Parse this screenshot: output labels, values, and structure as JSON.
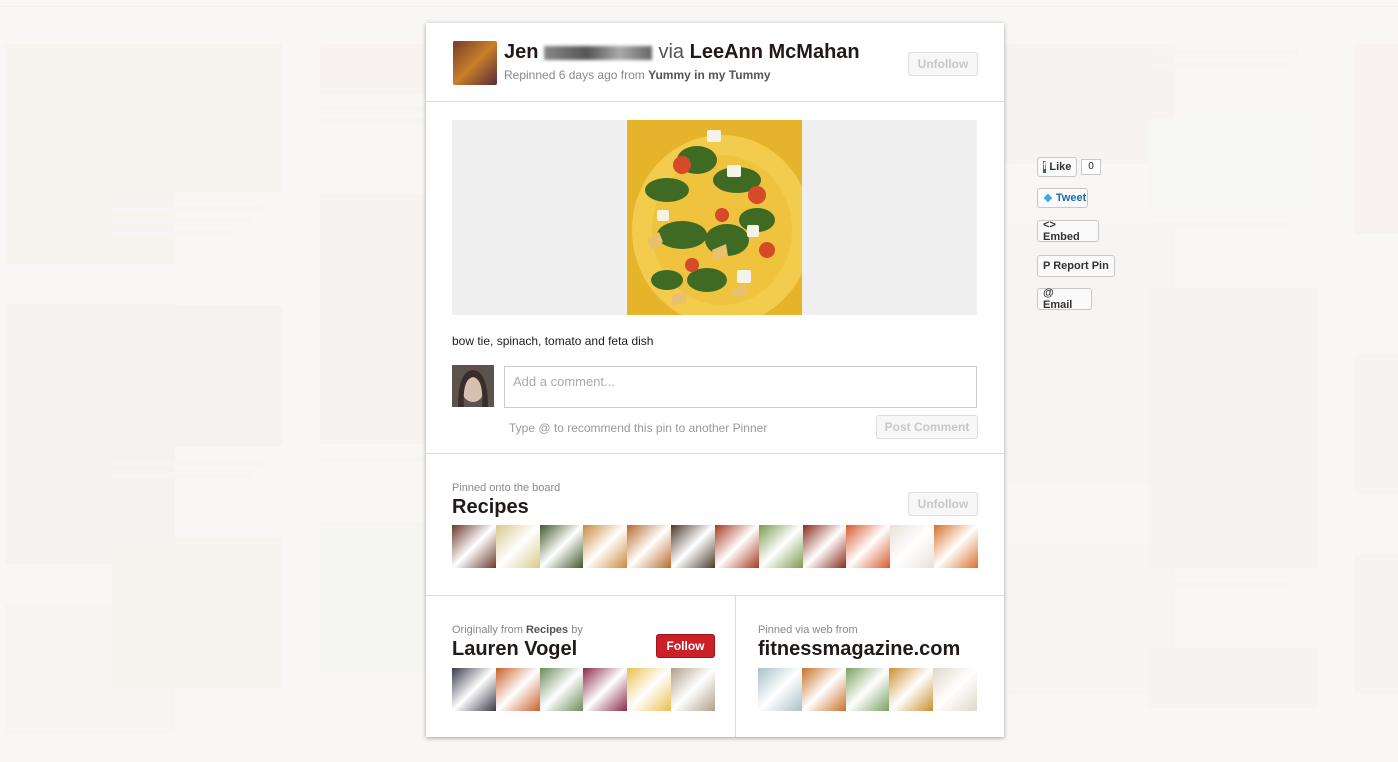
{
  "pin": {
    "pinner_first_name": "Jen",
    "via_text": "via",
    "via_user": "LeeAnn McMahan",
    "repinned_text": "Repinned 6 days ago from",
    "source_board": "Yummy in my Tummy",
    "unfollow_label": "Unfollow",
    "description": "bow tie, spinach, tomato and feta dish"
  },
  "comment": {
    "placeholder": "Add a comment...",
    "hint": "Type @ to recommend this pin to another Pinner",
    "post_label": "Post Comment"
  },
  "board": {
    "caption": "Pinned onto the board",
    "name": "Recipes",
    "unfollow_label": "Unfollow",
    "thumb_colors": [
      "#6b3a2a",
      "#d8c98a",
      "#3f5a2a",
      "#c98b3a",
      "#b86a2a",
      "#4a3a2a",
      "#a8381e",
      "#7c9a4a",
      "#8a2a1e",
      "#d8582a",
      "#e8e0d8",
      "#d8702a"
    ]
  },
  "origin": {
    "caption_prefix": "Originally from",
    "caption_board": "Recipes",
    "caption_suffix": "by",
    "user_name": "Lauren Vogel",
    "follow_label": "Follow",
    "thumb_colors": [
      "#3a3a4a",
      "#c8602a",
      "#6a8a5a",
      "#8a2a4a",
      "#e8c050",
      "#b0a08a"
    ]
  },
  "source": {
    "caption": "Pinned via web from",
    "site": "fitnessmagazine.com",
    "thumb_colors": [
      "#a8c0c8",
      "#c8702a",
      "#7aa060",
      "#c89030",
      "#e0d8c8"
    ]
  },
  "share": {
    "like_label": "Like",
    "like_count": "0",
    "tweet_label": "Tweet",
    "embed_label": "<> Embed",
    "report_label": "P Report Pin",
    "email_label": "@ Email"
  },
  "icons": {
    "facebook": "facebook-icon",
    "twitter": "twitter-icon"
  }
}
